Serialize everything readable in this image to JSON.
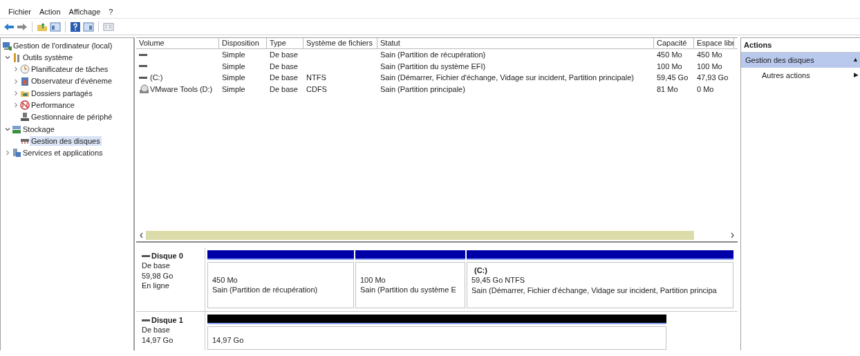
{
  "menu": [
    {
      "label": "Fichier"
    },
    {
      "label": "Action"
    },
    {
      "label": "Affichage"
    },
    {
      "label": "?"
    }
  ],
  "tree": [
    {
      "label": "Gestion de l'ordinateur (local)",
      "selected": false,
      "children": [
        {
          "label": "Outils système",
          "expanded": true,
          "selected": false,
          "children": [
            {
              "label": "Planificateur de tâches",
              "expanded": false,
              "selected": false
            },
            {
              "label": "Observateur d'événeme",
              "expanded": false,
              "selected": false
            },
            {
              "label": "Dossiers partagés",
              "expanded": false,
              "selected": false
            },
            {
              "label": "Performance",
              "expanded": false,
              "selected": false
            },
            {
              "label": "Gestionnaire de périphé",
              "selected": false
            }
          ]
        },
        {
          "label": "Stockage",
          "expanded": true,
          "selected": false,
          "children": [
            {
              "label": "Gestion des disques",
              "selected": true
            }
          ]
        },
        {
          "label": "Services et applications",
          "expanded": false,
          "selected": false
        }
      ]
    }
  ],
  "table": {
    "columns": [
      "Volume",
      "Disposition",
      "Type",
      "Système de fichiers",
      "Statut",
      "Capacité",
      "Espace libr"
    ],
    "rows": [
      {
        "kind": "disk",
        "cells": [
          "",
          "Simple",
          "De base",
          "",
          "Sain (Partition de récupération)",
          "450 Mo",
          "450 Mo"
        ]
      },
      {
        "kind": "disk",
        "cells": [
          "",
          "Simple",
          "De base",
          "",
          "Sain (Partition du système EFI)",
          "100 Mo",
          "100 Mo"
        ]
      },
      {
        "kind": "disk",
        "cells": [
          "(C:)",
          "Simple",
          "De base",
          "NTFS",
          "Sain (Démarrer, Fichier d'échange, Vidage sur incident, Partition principale)",
          "59,45 Go",
          "47,93 Go"
        ]
      },
      {
        "kind": "cdrom",
        "cells": [
          "VMware Tools (D:)",
          "Simple",
          "De base",
          "CDFS",
          "Sain (Partition principale)",
          "81 Mo",
          "0 Mo"
        ]
      }
    ]
  },
  "disks": [
    {
      "name": "Disque 0",
      "lines": [
        "De base",
        "59,98 Go",
        "En ligne"
      ],
      "partitions": [
        {
          "color": "#0000a8",
          "lines": [
            "450 Mo",
            "Sain (Partition de récupération)"
          ]
        },
        {
          "color": "#0000a8",
          "lines": [
            "100 Mo",
            "Sain (Partition du système E"
          ]
        },
        {
          "color": "#0000a8",
          "title": "(C:)",
          "lines": [
            "59,45 Go NTFS",
            "Sain (Démarrer, Fichier d'échange, Vidage sur incident, Partition principa"
          ]
        }
      ]
    },
    {
      "name": "Disque 1",
      "lines": [
        "De base",
        "14,97 Go"
      ],
      "partitions": [
        {
          "color": "#000000",
          "lines": [
            "14,97 Go"
          ]
        }
      ]
    }
  ],
  "actions": {
    "title": "Actions",
    "items": [
      {
        "kind": "section",
        "label": "Gestion des disques",
        "glyph": "▲"
      },
      {
        "kind": "action",
        "label": "Autres actions",
        "glyph": "▶"
      }
    ]
  }
}
